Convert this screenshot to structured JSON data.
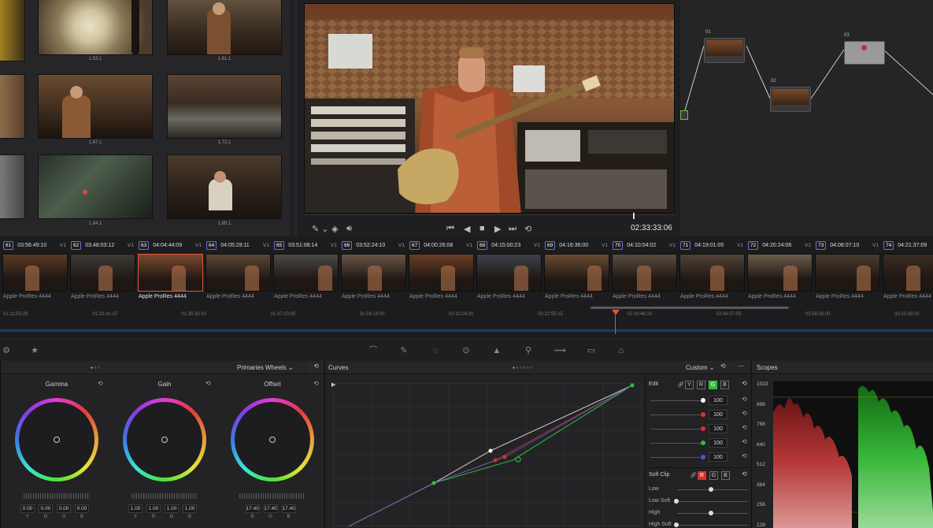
{
  "media_pool": {
    "clips": [
      {
        "label": "1.53.1"
      },
      {
        "label": "1.61.1"
      },
      {
        "label": "1.67.1"
      },
      {
        "label": "1.72.1"
      },
      {
        "label": "1.84.1"
      },
      {
        "label": "1.85.1"
      }
    ]
  },
  "viewer": {
    "timecode": "02:33:33:06"
  },
  "nodes": {
    "items": [
      {
        "num": "01"
      },
      {
        "num": "02"
      },
      {
        "num": "03"
      }
    ]
  },
  "timeline": {
    "clips": [
      {
        "num": "61",
        "tc": "03:56:49:10",
        "track": "V1",
        "name": "Apple ProRes 4444",
        "selected": false
      },
      {
        "num": "62",
        "tc": "03:48:03:12",
        "track": "V1",
        "name": "Apple ProRes 4444",
        "selected": false
      },
      {
        "num": "63",
        "tc": "04:04:44:09",
        "track": "V1",
        "name": "Apple ProRes 4444",
        "selected": true
      },
      {
        "num": "64",
        "tc": "04:05:29:11",
        "track": "V1",
        "name": "Apple ProRes 4444",
        "selected": false
      },
      {
        "num": "65",
        "tc": "03:51:08:14",
        "track": "V1",
        "name": "Apple ProRes 4444",
        "selected": false
      },
      {
        "num": "66",
        "tc": "03:52:24:10",
        "track": "V1",
        "name": "Apple ProRes 4444",
        "selected": false
      },
      {
        "num": "67",
        "tc": "04:00:26:08",
        "track": "V1",
        "name": "Apple ProRes 4444",
        "selected": false
      },
      {
        "num": "68",
        "tc": "04:15:00:23",
        "track": "V1",
        "name": "Apple ProRes 4444",
        "selected": false
      },
      {
        "num": "69",
        "tc": "04:16:36:00",
        "track": "V1",
        "name": "Apple ProRes 4444",
        "selected": false
      },
      {
        "num": "70",
        "tc": "04:10:04:02",
        "track": "V1",
        "name": "Apple ProRes 4444",
        "selected": false
      },
      {
        "num": "71",
        "tc": "04:19:01:05",
        "track": "V1",
        "name": "Apple ProRes 4444",
        "selected": false
      },
      {
        "num": "72",
        "tc": "04:20:24:06",
        "track": "V1",
        "name": "Apple ProRes 4444",
        "selected": false
      },
      {
        "num": "73",
        "tc": "04:08:07:10",
        "track": "V1",
        "name": "Apple ProRes 4444",
        "selected": false
      },
      {
        "num": "74",
        "tc": "04:21:37:09",
        "track": "",
        "name": "Apple ProRes 4444",
        "selected": false
      }
    ],
    "ruler": [
      "01:11:50:20",
      "01:23:41:15",
      "01:35:32:10",
      "01:47:23:05",
      "01:59:14:00",
      "02:11:04:20",
      "02:22:55:15",
      "02:34:46:10",
      "02:46:37:05",
      "02:58:28:00",
      "03:10:18:20"
    ]
  },
  "primaries": {
    "mode": "Primaries Wheels",
    "wheels": [
      {
        "title": "Gamma",
        "values": [
          "0.00",
          "0.00",
          "0.00",
          "0.00"
        ],
        "labels": [
          "Y",
          "R",
          "G",
          "B"
        ]
      },
      {
        "title": "Gain",
        "values": [
          "1.00",
          "1.00",
          "1.00",
          "1.00"
        ],
        "labels": [
          "Y",
          "R",
          "G",
          "B"
        ]
      },
      {
        "title": "Offset",
        "values": [
          "17.40",
          "17.40",
          "17.40"
        ],
        "labels": [
          "R",
          "G",
          "B"
        ]
      }
    ]
  },
  "curves": {
    "title": "Curves",
    "mode": "Custom",
    "edit_label": "Edit",
    "channel_buttons": [
      "Y",
      "R",
      "G",
      "B"
    ],
    "edit_values": [
      "100",
      "100",
      "100",
      "100",
      "100"
    ],
    "soft_clip_label": "Soft Clip",
    "soft_clip_buttons": [
      "R",
      "G",
      "B"
    ],
    "soft_clip_rows": [
      "Low",
      "Low Soft",
      "High",
      "High Soft"
    ]
  },
  "scopes": {
    "title": "Scopes",
    "ticks": [
      "1023",
      "896",
      "768",
      "640",
      "512",
      "384",
      "256",
      "128"
    ]
  },
  "colors": {
    "accent_orange": "#e0553a",
    "clip_number_border": "#6a6fd8",
    "green_active": "#2fbf3a"
  }
}
